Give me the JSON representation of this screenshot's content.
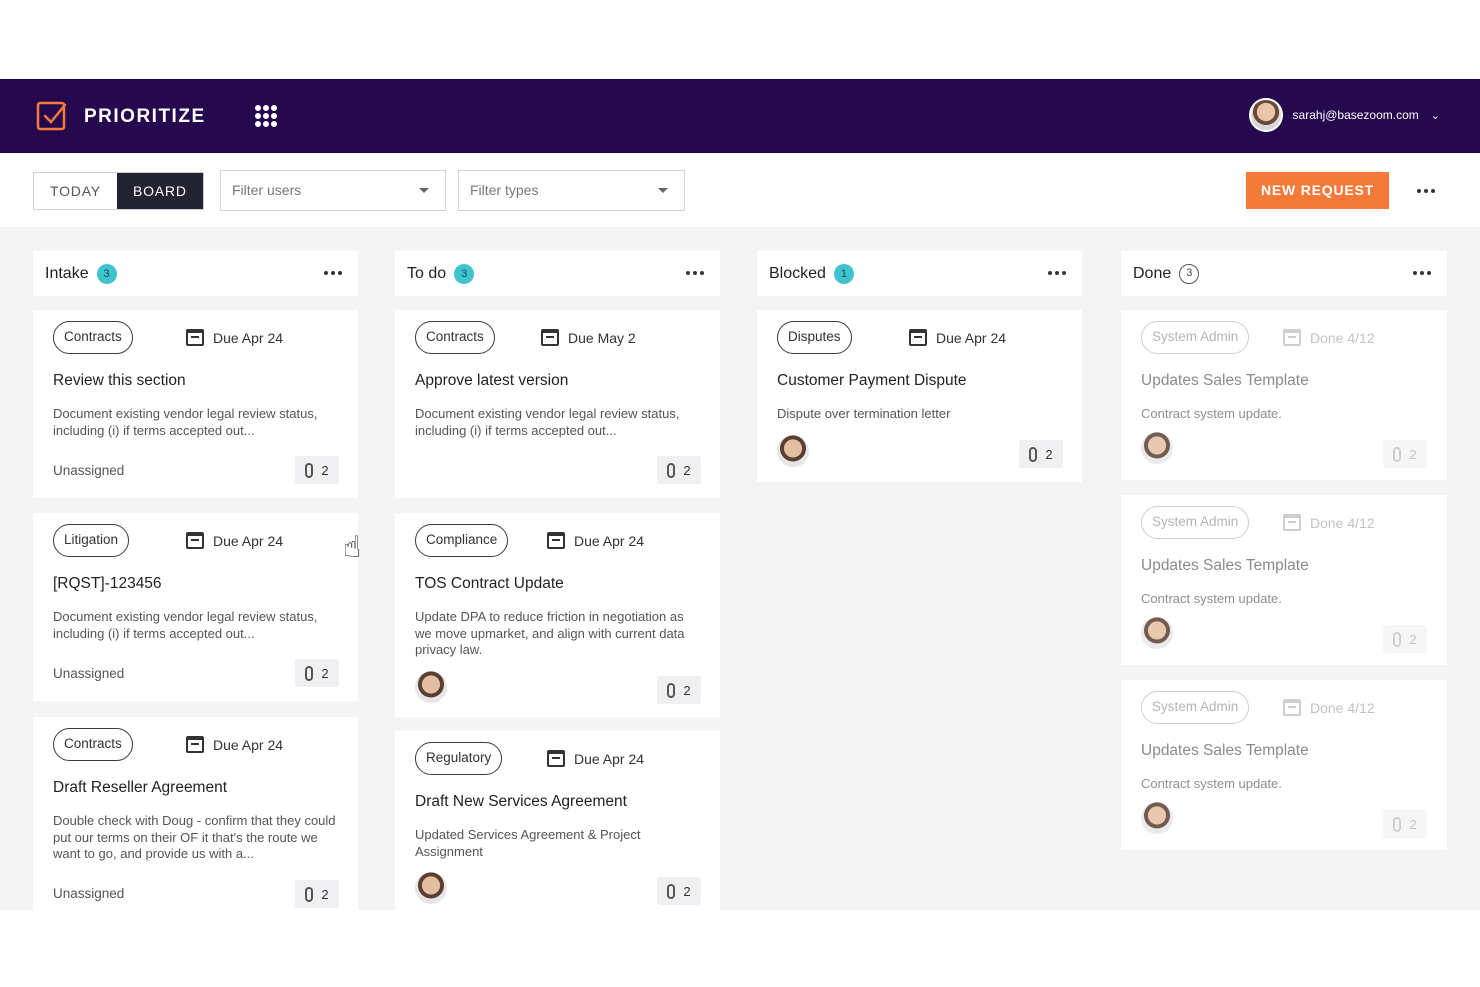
{
  "app": {
    "name": "PRIORITIZE",
    "user_email": "sarahj@basezoom.com"
  },
  "toolbar": {
    "view_today": "TODAY",
    "view_board": "BOARD",
    "filter_users_placeholder": "Filter users",
    "filter_types_placeholder": "Filter types",
    "new_request_label": "NEW REQUEST"
  },
  "columns": [
    {
      "title": "Intake",
      "count": "3"
    },
    {
      "title": "To do",
      "count": "3"
    },
    {
      "title": "Blocked",
      "count": "1"
    },
    {
      "title": "Done",
      "count": "3"
    }
  ],
  "cards": {
    "intake": [
      {
        "tag": "Contracts",
        "due": "Due Apr 24",
        "title": "Review this section",
        "desc": "Document existing vendor legal review status, including (i) if terms accepted out...",
        "assignee": "Unassigned",
        "attachments": "2"
      },
      {
        "tag": "Litigation",
        "due": "Due Apr 24",
        "title": "[RQST]-123456",
        "desc": "Document existing vendor legal review status, including (i) if terms accepted out...",
        "assignee": "Unassigned",
        "attachments": "2"
      },
      {
        "tag": "Contracts",
        "due": "Due Apr 24",
        "title": "Draft Reseller Agreement",
        "desc": "Double check with Doug - confirm that they could put our terms on their OF it that's the route we want to go, and provide us with a...",
        "assignee": "Unassigned",
        "attachments": "2"
      }
    ],
    "todo": [
      {
        "tag": "Contracts",
        "due": "Due May 2",
        "title": "Approve latest version",
        "desc": "Document existing vendor legal review status, including (i) if terms accepted out...",
        "attachments": "2"
      },
      {
        "tag": "Compliance",
        "due": "Due Apr 24",
        "title": "TOS Contract Update",
        "desc": "Update DPA to reduce friction in negotiation as we move upmarket, and align with current data privacy law.",
        "attachments": "2"
      },
      {
        "tag": "Regulatory",
        "due": "Due Apr 24",
        "title": "Draft New Services Agreement",
        "desc": "Updated Services Agreement & Project Assignment",
        "attachments": "2"
      }
    ],
    "blocked": [
      {
        "tag": "Disputes",
        "due": "Due Apr 24",
        "title": "Customer Payment Dispute",
        "desc": "Dispute over termination letter",
        "attachments": "2"
      }
    ],
    "done": [
      {
        "tag": "System Admin",
        "due": "Done 4/12",
        "title": "Updates Sales Template",
        "desc": "Contract system update.",
        "attachments": "2"
      },
      {
        "tag": "System Admin",
        "due": "Done 4/12",
        "title": "Updates Sales Template",
        "desc": "Contract system update.",
        "attachments": "2"
      },
      {
        "tag": "System Admin",
        "due": "Done 4/12",
        "title": "Updates Sales Template",
        "desc": "Contract system update.",
        "attachments": "2"
      }
    ]
  },
  "icons": {
    "logo": "checkbox-logo-icon",
    "apps": "grid-apps-icon",
    "calendar": "calendar-icon",
    "attachment": "paperclip-icon",
    "more": "more-horizontal-icon",
    "cursor": "hand-pointer-icon"
  },
  "colors": {
    "header_bg": "#25084d",
    "accent": "#f47a3a",
    "badge": "#3fc3cf",
    "board_bg": "#f4f4f5"
  }
}
